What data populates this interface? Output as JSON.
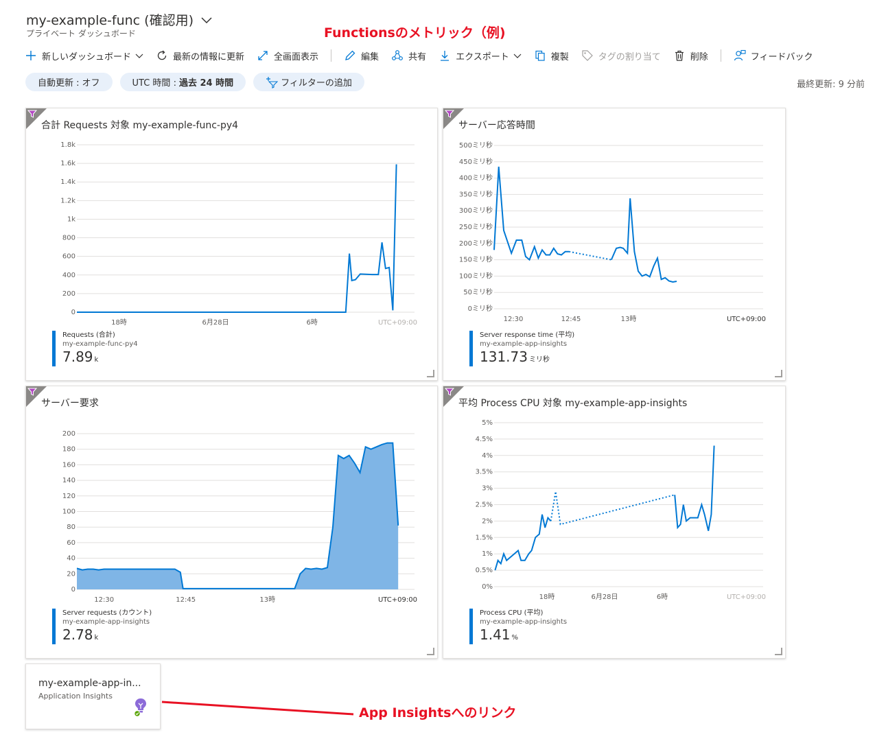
{
  "header": {
    "title": "my-example-func (確認用)",
    "subtitle": "プライベート ダッシュボード",
    "annotation": "Functionsのメトリック（例)"
  },
  "toolbar": {
    "new_dashboard": "新しいダッシュボード",
    "refresh": "最新の情報に更新",
    "fullscreen": "全画面表示",
    "edit": "編集",
    "share": "共有",
    "export": "エクスポート",
    "clone": "複製",
    "assign_tags": "タグの割り当て",
    "delete": "削除",
    "feedback": "フィードバック"
  },
  "filters": {
    "auto_refresh_label": "自動更新 :",
    "auto_refresh_value": "オフ",
    "time_label": "UTC 時間 :",
    "time_value": "過去 24 時間",
    "add_filter": "フィルターの追加"
  },
  "last_updated": "最終更新: 9 分前",
  "app_tile": {
    "name": "my-example-app-in...",
    "type": "Application Insights",
    "annotation": "App Insightsへのリンク"
  },
  "colors": {
    "accent": "#0078d4",
    "annotation": "#e81123",
    "filter_corner": "#8a8886"
  },
  "chart_data": [
    {
      "type": "line",
      "title": "合計 Requests 対象 my-example-func-py4",
      "xticks": [
        "18時",
        "6月28日",
        "6時",
        "UTC+09:00"
      ],
      "yticks": [
        "1.8k",
        "1.6k",
        "1.4k",
        "1.2k",
        "1k",
        "800",
        "600",
        "400",
        "200",
        "0"
      ],
      "ylim": [
        0,
        1800
      ],
      "xlim": [
        0,
        28
      ],
      "tick_positions": [
        3.5,
        11.5,
        19.5
      ],
      "series": [
        {
          "name": "Requests (合計)",
          "x": [
            0,
            22.3,
            22.6,
            22.8,
            23.1,
            23.5,
            24.5,
            25.0,
            25.3,
            25.6,
            25.9,
            26.2,
            26.5
          ],
          "values": [
            0,
            0,
            630,
            340,
            350,
            410,
            405,
            405,
            750,
            470,
            480,
            20,
            1590
          ]
        }
      ],
      "legend": {
        "label": "Requests (合計)",
        "sub": "my-example-func-py4",
        "value": "7.89",
        "unit": "k"
      }
    },
    {
      "type": "line",
      "title": "サーバー応答時間",
      "xticks": [
        "12:30",
        "12:45",
        "13時",
        "UTC+09:00"
      ],
      "yticks": [
        "500ミリ秒",
        "450ミリ秒",
        "400ミリ秒",
        "350ミリ秒",
        "300ミリ秒",
        "250ミリ秒",
        "200ミリ秒",
        "150ミリ秒",
        "100ミリ秒",
        "50ミリ秒",
        "0ミリ秒"
      ],
      "ylim": [
        0,
        500
      ],
      "xlim": [
        0,
        70
      ],
      "tick_positions": [
        5,
        20,
        35
      ],
      "series": [
        {
          "name": "Server response time (平均)",
          "segments": [
            {
              "style": "solid",
              "x": [
                0,
                1.2,
                2.5,
                4.5,
                5.8,
                7.2,
                8.2,
                9.2,
                10.5,
                11.5,
                12.5,
                13.5,
                14.5,
                15.5,
                16.5,
                17.5,
                18.5,
                19.5
              ],
              "values": [
                180,
                435,
                240,
                170,
                210,
                210,
                160,
                150,
                190,
                155,
                180,
                165,
                165,
                185,
                168,
                165,
                175,
                175
              ]
            },
            {
              "style": "dotted",
              "x": [
                19.5,
                30.5
              ],
              "values": [
                175,
                150
              ]
            },
            {
              "style": "solid",
              "x": [
                30.5,
                31.8,
                32.8,
                33.6,
                34.7,
                35.4,
                36.5,
                37.5,
                38.5,
                39.5,
                40.5,
                41.5,
                42.5,
                43.5,
                44.5,
                45.5,
                46.5,
                47.5
              ],
              "values": [
                150,
                185,
                188,
                185,
                170,
                338,
                175,
                115,
                100,
                105,
                98,
                130,
                155,
                90,
                95,
                85,
                82,
                84
              ]
            }
          ]
        }
      ],
      "legend": {
        "label": "Server response time (平均)",
        "sub": "my-example-app-insights",
        "value": "131.73",
        "unit": "ミリ秒"
      }
    },
    {
      "type": "area",
      "title": "サーバー要求",
      "xticks": [
        "12:30",
        "12:45",
        "13時",
        "UTC+09:00"
      ],
      "yticks": [
        "200",
        "180",
        "160",
        "140",
        "120",
        "100",
        "80",
        "60",
        "40",
        "20",
        "0"
      ],
      "ylim": [
        0,
        200
      ],
      "xlim": [
        0,
        62
      ],
      "tick_positions": [
        5,
        20,
        35
      ],
      "series": [
        {
          "name": "Server requests (カウント)",
          "x": [
            0,
            1,
            2,
            3,
            4,
            5,
            6,
            7,
            8,
            9,
            10,
            11,
            12,
            13,
            14,
            15,
            16,
            17,
            18,
            19,
            19.5,
            20.5,
            40,
            41,
            42,
            43,
            44,
            45,
            46,
            47,
            48,
            49,
            50,
            51,
            52,
            53,
            54,
            55,
            56,
            57,
            58,
            59
          ],
          "values": [
            27,
            25,
            26,
            26,
            25,
            26,
            26,
            26,
            26,
            26,
            26,
            26,
            26,
            26,
            26,
            26,
            26,
            26,
            26,
            22,
            1,
            1,
            1,
            20,
            27,
            26,
            27,
            26,
            28,
            80,
            172,
            168,
            172,
            162,
            150,
            183,
            180,
            183,
            186,
            188,
            188,
            82
          ]
        }
      ],
      "legend": {
        "label": "Server requests (カウント)",
        "sub": "my-example-app-insights",
        "value": "2.78",
        "unit": "k"
      }
    },
    {
      "type": "line",
      "title": "平均 Process CPU 対象 my-example-app-insights",
      "xticks": [
        "18時",
        "6月28日",
        "6時",
        "UTC+09:00"
      ],
      "yticks": [
        "5%",
        "4.5%",
        "4%",
        "3.5%",
        "3%",
        "2.5%",
        "2%",
        "1.5%",
        "1%",
        "0.5%",
        "0%"
      ],
      "ylim": [
        0,
        5
      ],
      "xlim": [
        0,
        28
      ],
      "tick_positions": [
        5.5,
        11.5,
        17.5
      ],
      "series": [
        {
          "name": "Process CPU (平均)",
          "segments": [
            {
              "style": "solid",
              "x": [
                0.1,
                0.4,
                0.7,
                1.0,
                1.3,
                1.7,
                2.1,
                2.5,
                2.8,
                3.2,
                3.6,
                3.9,
                4.3,
                4.7,
                5.0,
                5.3,
                5.6,
                5.9
              ],
              "values": [
                0.5,
                0.8,
                0.7,
                1.0,
                0.8,
                0.9,
                1.0,
                1.1,
                0.8,
                0.8,
                1.0,
                1.1,
                1.5,
                1.6,
                2.2,
                1.8,
                2.1,
                2.0
              ]
            },
            {
              "style": "dotted",
              "x": [
                5.9,
                6.4,
                6.9,
                18.8
              ],
              "values": [
                2.0,
                2.9,
                1.9,
                2.8
              ]
            },
            {
              "style": "solid",
              "x": [
                18.8,
                19.1,
                19.4,
                19.7,
                20.0,
                20.4,
                20.8,
                21.2,
                21.6,
                21.9,
                22.3,
                22.6,
                22.9
              ],
              "values": [
                2.8,
                1.8,
                1.9,
                2.5,
                2.0,
                2.1,
                2.1,
                2.1,
                2.5,
                2.2,
                1.7,
                2.2,
                4.3
              ]
            }
          ]
        }
      ],
      "legend": {
        "label": "Process CPU (平均)",
        "sub": "my-example-app-insights",
        "value": "1.41",
        "unit": "%"
      }
    }
  ]
}
